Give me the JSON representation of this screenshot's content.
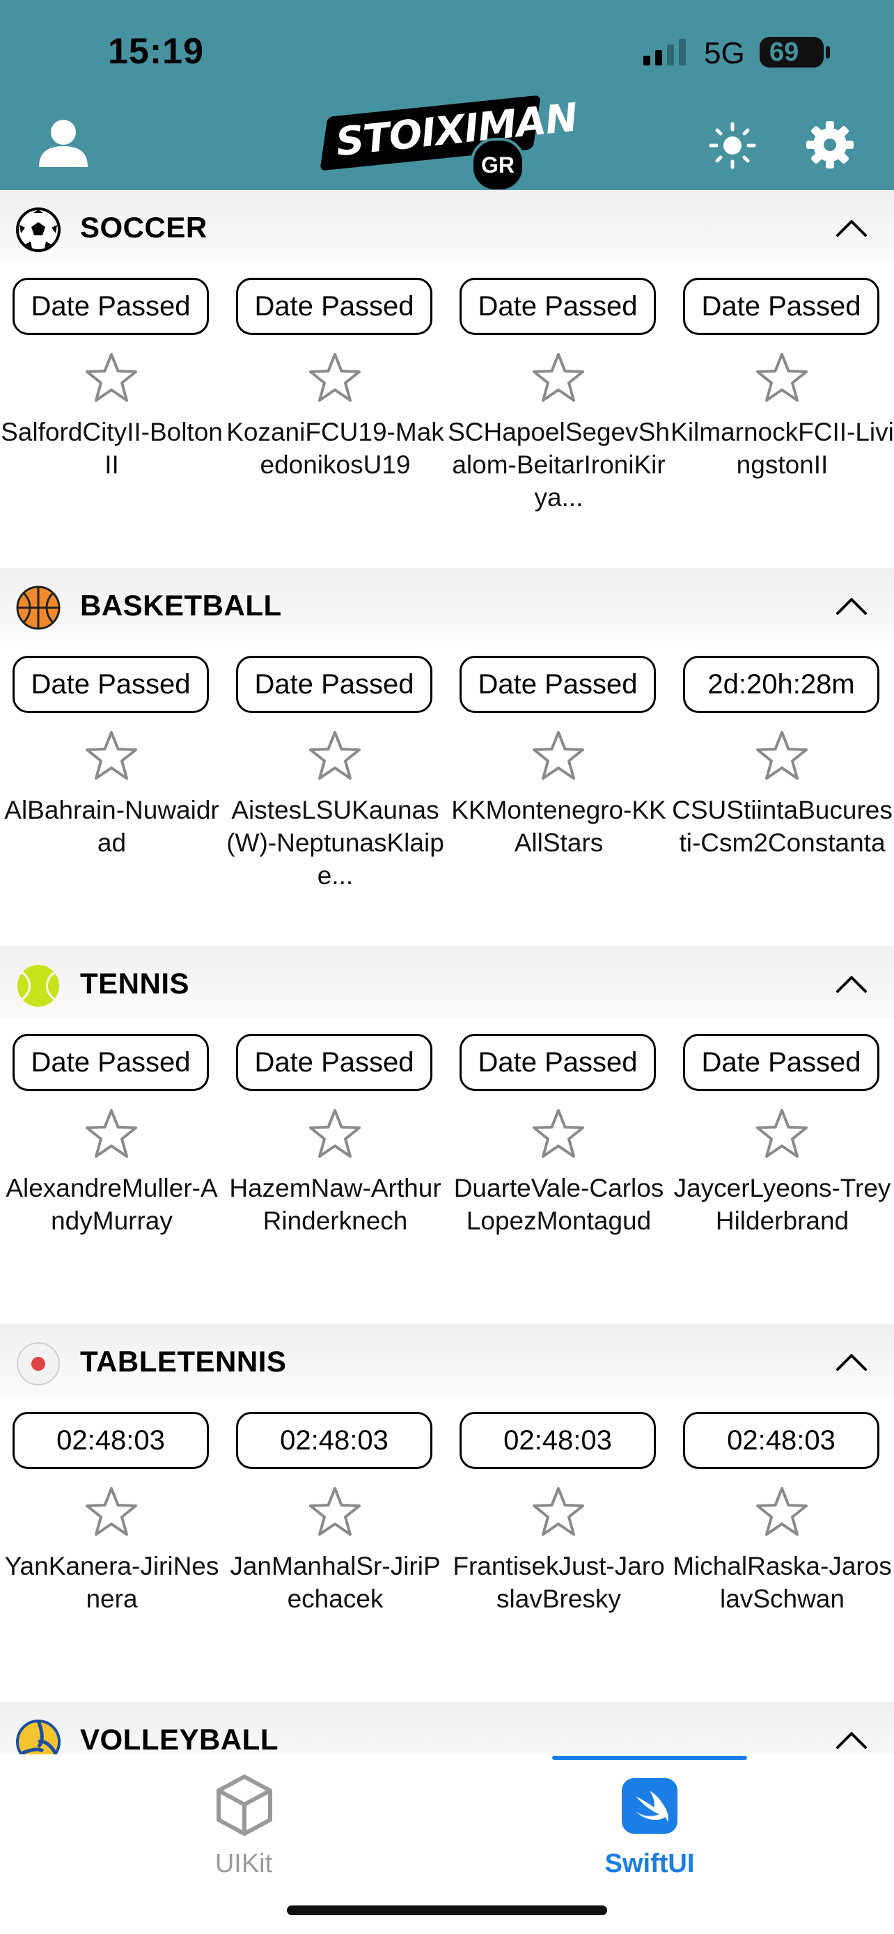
{
  "status": {
    "time": "15:19",
    "network": "5G",
    "battery": "69"
  },
  "header": {
    "logo_text": "STOIXIMAN",
    "logo_badge": "GR"
  },
  "sections": [
    {
      "title": "SOCCER",
      "icon": "soccer-ball-icon",
      "cards": [
        {
          "status": "Date Passed",
          "match": "SalfordCityII-BoltonII"
        },
        {
          "status": "Date Passed",
          "match": "KozaniFCU19-MakedonikosU19"
        },
        {
          "status": "Date Passed",
          "match": "SCHapoelSegevShalom-BeitarIroniKirya..."
        },
        {
          "status": "Date Passed",
          "match": "KilmarnockFCII-LivingstonII"
        }
      ]
    },
    {
      "title": "BASKETBALL",
      "icon": "basketball-icon",
      "cards": [
        {
          "status": "Date Passed",
          "match": "AlBahrain-Nuwaidrad"
        },
        {
          "status": "Date Passed",
          "match": "AistesLSUKaunas(W)-NeptunasKlaipe..."
        },
        {
          "status": "Date Passed",
          "match": "KKMontenegro-KKAllStars"
        },
        {
          "status": "2d:20h:28m",
          "match": "CSUStiintaBucuresti-Csm2Constanta"
        }
      ]
    },
    {
      "title": "TENNIS",
      "icon": "tennis-ball-icon",
      "cards": [
        {
          "status": "Date Passed",
          "match": "AlexandreMuller-AndyMurray"
        },
        {
          "status": "Date Passed",
          "match": "HazemNaw-ArthurRinderknech"
        },
        {
          "status": "Date Passed",
          "match": "DuarteVale-CarlosLopezMontagud"
        },
        {
          "status": "Date Passed",
          "match": "JaycerLyeons-TreyHilderbrand"
        }
      ]
    },
    {
      "title": "TABLETENNIS",
      "icon": "table-tennis-ball-icon",
      "cards": [
        {
          "status": "02:48:03",
          "match": "YanKanera-JiriNesnera"
        },
        {
          "status": "02:48:03",
          "match": "JanManhalSr-JiriPechacek"
        },
        {
          "status": "02:48:03",
          "match": "FrantisekJust-JaroslavBresky"
        },
        {
          "status": "02:48:03",
          "match": "MichalRaska-JaroslavSchwan"
        }
      ]
    },
    {
      "title": "VOLLEYBALL",
      "icon": "volleyball-icon",
      "cards": []
    }
  ],
  "tabbar": {
    "tabs": [
      {
        "label": "UIKit",
        "icon": "uikit-box-icon",
        "selected": false
      },
      {
        "label": "SwiftUI",
        "icon": "swift-icon",
        "selected": true
      }
    ],
    "accent": "#1a7ee6"
  },
  "colors": {
    "header": "#4692a1"
  }
}
